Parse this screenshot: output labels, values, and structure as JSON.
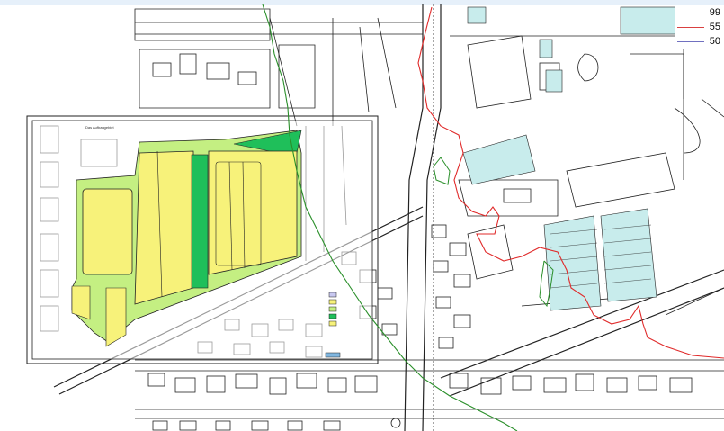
{
  "legend": {
    "items": [
      {
        "label": "99",
        "color": "#000000"
      },
      {
        "label": "55",
        "color": "#d94040"
      },
      {
        "label": "50",
        "color": "#7070c0"
      }
    ]
  },
  "colors": {
    "yellow": "#f7f27a",
    "light_green": "#c4ef82",
    "dark_green": "#1fbf5a",
    "cyan": "#c8ecec",
    "red_line": "#e02a2a",
    "green_line": "#2a8f2a",
    "linework": "#222222"
  },
  "small_label": "Das Aufbaugebiet"
}
